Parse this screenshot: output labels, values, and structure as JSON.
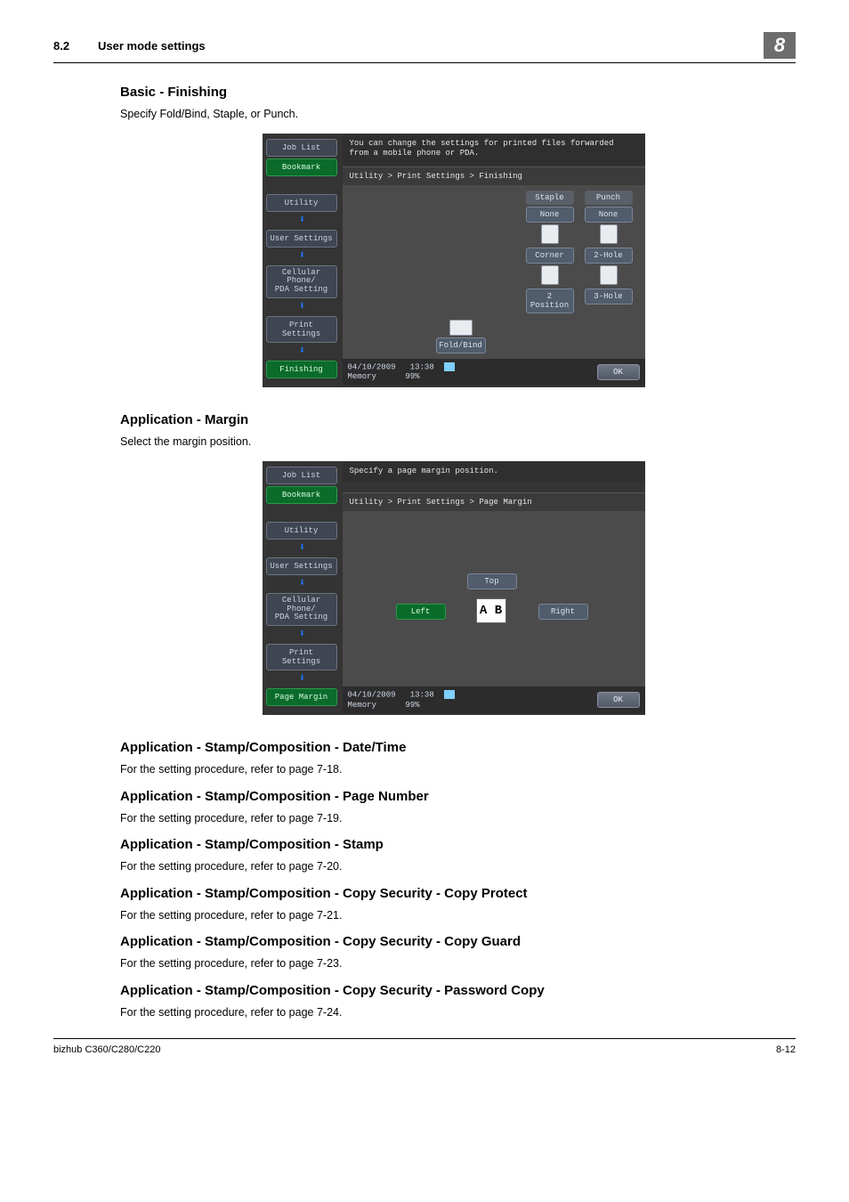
{
  "header": {
    "section_number": "8.2",
    "section_title": "User mode settings",
    "chapter": "8"
  },
  "sections": [
    {
      "heading": "Basic - Finishing",
      "body": "Specify Fold/Bind, Staple, or Punch.",
      "screenshot": "finishing"
    },
    {
      "heading": "Application - Margin",
      "body": "Select the margin position.",
      "screenshot": "margin"
    },
    {
      "heading": "Application - Stamp/Composition - Date/Time",
      "body": "For the setting procedure, refer to page 7-18."
    },
    {
      "heading": "Application - Stamp/Composition - Page Number",
      "body": "For the setting procedure, refer to page 7-19."
    },
    {
      "heading": "Application - Stamp/Composition - Stamp",
      "body": "For the setting procedure, refer to page 7-20."
    },
    {
      "heading": "Application - Stamp/Composition - Copy Security - Copy Protect",
      "body": "For the setting procedure, refer to page 7-21."
    },
    {
      "heading": "Application - Stamp/Composition - Copy Security - Copy Guard",
      "body": "For the setting procedure, refer to page 7-23."
    },
    {
      "heading": "Application - Stamp/Composition - Copy Security - Password Copy",
      "body": "For the setting procedure, refer to page 7-24."
    }
  ],
  "screenshot_finishing": {
    "left_nav": {
      "job_list": "Job List",
      "bookmark": "Bookmark",
      "utility": "Utility",
      "user_settings": "User Settings",
      "cellular": "Cellular Phone/\nPDA Setting",
      "print_settings": "Print Settings",
      "finishing": "Finishing"
    },
    "top_text": "You can change the settings for printed files forwarded\nfrom a mobile phone or PDA.",
    "breadcrumb": "Utility > Print Settings > Finishing",
    "headers": {
      "staple": "Staple",
      "punch": "Punch"
    },
    "options": {
      "staple_none": "None",
      "punch_none": "None",
      "staple_corner": "Corner",
      "punch_2hole": "2-Hole",
      "staple_2pos": "2 Position",
      "punch_3hole": "3-Hole",
      "fold_bind": "Fold/Bind"
    },
    "status": {
      "date": "04/10/2009",
      "time": "13:38",
      "memory_label": "Memory",
      "memory_val": "99%"
    },
    "ok": "OK"
  },
  "screenshot_margin": {
    "left_nav": {
      "job_list": "Job List",
      "bookmark": "Bookmark",
      "utility": "Utility",
      "user_settings": "User Settings",
      "cellular": "Cellular Phone/\nPDA Setting",
      "print_settings": "Print Settings",
      "page_margin": "Page Margin"
    },
    "top_text": "Specify a page margin position.",
    "breadcrumb": "Utility > Print Settings > Page Margin",
    "options": {
      "top": "Top",
      "left": "Left",
      "right": "Right",
      "ab": "A B"
    },
    "status": {
      "date": "04/10/2009",
      "time": "13:38",
      "memory_label": "Memory",
      "memory_val": "99%"
    },
    "ok": "OK"
  },
  "footer": {
    "left": "bizhub C360/C280/C220",
    "right": "8-12"
  }
}
